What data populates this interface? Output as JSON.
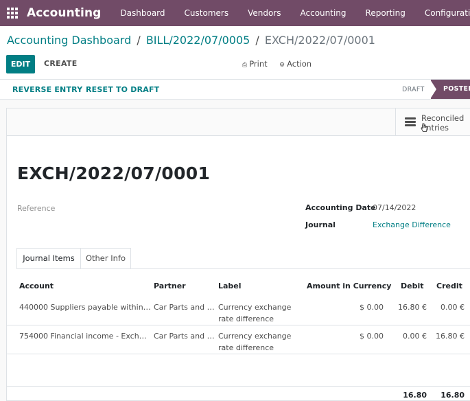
{
  "app": {
    "title": "Accounting"
  },
  "menu": [
    "Dashboard",
    "Customers",
    "Vendors",
    "Accounting",
    "Reporting",
    "Configuration"
  ],
  "breadcrumb": {
    "items": [
      "Accounting Dashboard",
      "BILL/2022/07/0005"
    ],
    "separator": "/",
    "current": "EXCH/2022/07/0001"
  },
  "toolbar": {
    "edit_label": "EDIT",
    "create_label": "CREATE",
    "print_label": "Print",
    "action_label": "Action"
  },
  "statusbar": {
    "reverse_label": "REVERSE ENTRY",
    "reset_label": "RESET TO DRAFT",
    "stages": [
      "DRAFT",
      "POSTED"
    ],
    "active_stage": "POSTED"
  },
  "smart_button": {
    "label_line1": "Reconciled",
    "label_line2": "Entries"
  },
  "record": {
    "name": "EXCH/2022/07/0001",
    "reference_label": "Reference",
    "accounting_date_label": "Accounting Date",
    "accounting_date": "07/14/2022",
    "journal_label": "Journal",
    "journal": "Exchange Difference"
  },
  "tabs": [
    "Journal Items",
    "Other Info"
  ],
  "active_tab": "Journal Items",
  "grid": {
    "columns": [
      "Account",
      "Partner",
      "Label",
      "Amount in Currency",
      "Debit",
      "Credit"
    ],
    "rows": [
      {
        "account": "440000 Suppliers payable within on…",
        "partner": "Car Parts and …",
        "label": "Currency exchange rate difference",
        "amount_currency": "$ 0.00",
        "debit": "16.80 €",
        "credit": "0.00 €"
      },
      {
        "account": "754000 Financial income - Exchang…",
        "partner": "Car Parts and …",
        "label": "Currency exchange rate difference",
        "amount_currency": "$ 0.00",
        "debit": "0.00 €",
        "credit": "16.80 €"
      }
    ],
    "totals": {
      "debit": "16.80",
      "credit": "16.80"
    }
  },
  "colors": {
    "brand": "#714b67",
    "accent": "#017e84"
  },
  "icons": [
    "apps-grid-icon",
    "print-icon",
    "gear-icon",
    "hamburger-icon",
    "hand-cursor-icon"
  ]
}
